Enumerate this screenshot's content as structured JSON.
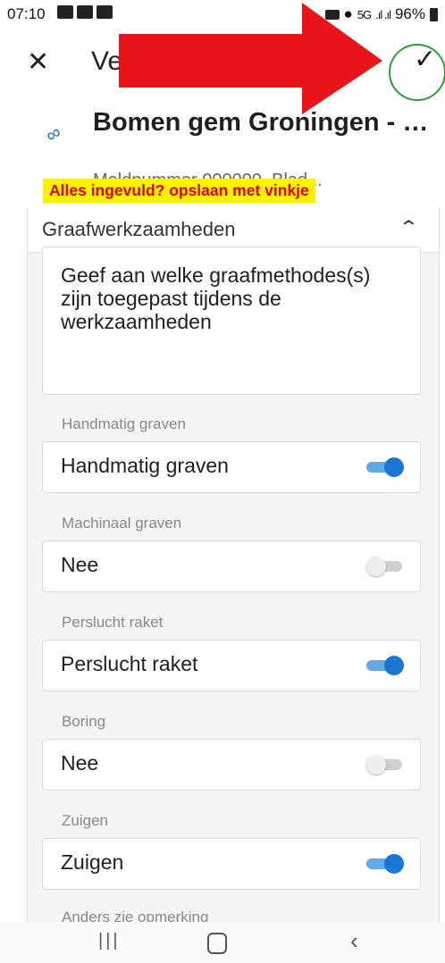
{
  "status_bar": {
    "time": "07:10",
    "network": "5G",
    "battery": "96%"
  },
  "top_bar": {
    "title": "Ve",
    "close_icon": "close-icon",
    "confirm_icon": "check-icon"
  },
  "record": {
    "title": "Bomen gem Groningen - G...",
    "subtitle": "Meldnummer 000000, Blad..."
  },
  "annotation": {
    "text": "Alles ingevuld? opslaan met vinkje",
    "arrow_color": "#e8141a",
    "circle_color": "#2e9c3a",
    "banner_color": "#fff200"
  },
  "section": {
    "title": "Graafwerkzaamheden",
    "info_text": "Geef aan welke graafmethodes(s) zijn toegepast tijdens de werkzaamheden"
  },
  "fields": [
    {
      "label": "Handmatig graven",
      "value": "Handmatig graven",
      "on": true
    },
    {
      "label": "Machinaal graven",
      "value": "Nee",
      "on": false
    },
    {
      "label": "Perslucht raket",
      "value": "Perslucht raket",
      "on": true
    },
    {
      "label": "Boring",
      "value": "Nee",
      "on": false
    },
    {
      "label": "Zuigen",
      "value": "Zuigen",
      "on": true
    },
    {
      "label": "Anders zie opmerking"
    }
  ],
  "colors": {
    "accent": "#1976d2",
    "toggle_track_on": "#64a8e8"
  }
}
